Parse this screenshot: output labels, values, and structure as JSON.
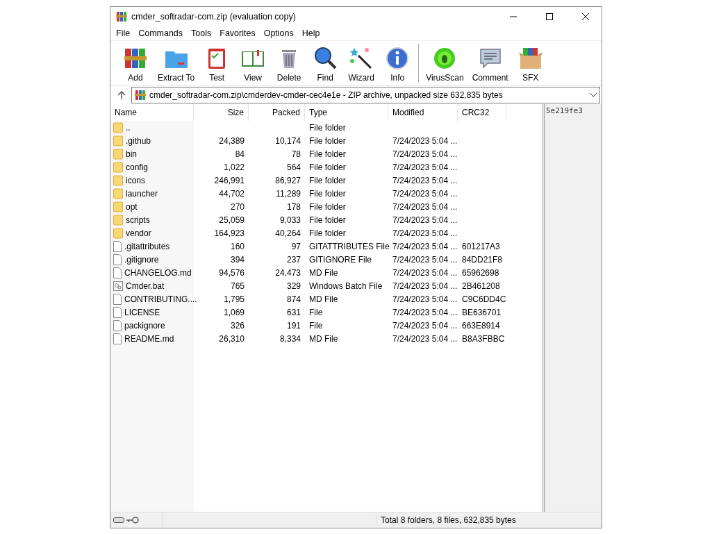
{
  "window": {
    "title": "cmder_softradar-com.zip (evaluation copy)"
  },
  "menu": [
    "File",
    "Commands",
    "Tools",
    "Favorites",
    "Options",
    "Help"
  ],
  "toolbar": [
    {
      "label": "Add",
      "kind": "add"
    },
    {
      "label": "Extract To",
      "kind": "extract"
    },
    {
      "label": "Test",
      "kind": "test"
    },
    {
      "label": "View",
      "kind": "view"
    },
    {
      "label": "Delete",
      "kind": "delete"
    },
    {
      "label": "Find",
      "kind": "find"
    },
    {
      "label": "Wizard",
      "kind": "wizard"
    },
    {
      "label": "Info",
      "kind": "info"
    },
    {
      "label": "VirusScan",
      "kind": "virus",
      "separated": true
    },
    {
      "label": "Comment",
      "kind": "comment"
    },
    {
      "label": "SFX",
      "kind": "sfx"
    }
  ],
  "address": "cmder_softradar-com.zip\\cmderdev-cmder-cec4e1e - ZIP archive, unpacked size 632,835 bytes",
  "table": {
    "columns": [
      "Name",
      "Size",
      "Packed",
      "Type",
      "Modified",
      "CRC32"
    ],
    "rows": [
      {
        "kind": "folder",
        "name": "..",
        "size": "",
        "packed": "",
        "type": "File folder",
        "modified": "",
        "crc": ""
      },
      {
        "kind": "folder",
        "name": ".github",
        "size": "24,389",
        "packed": "10,174",
        "type": "File folder",
        "modified": "7/24/2023 5:04 ...",
        "crc": ""
      },
      {
        "kind": "folder",
        "name": "bin",
        "size": "84",
        "packed": "78",
        "type": "File folder",
        "modified": "7/24/2023 5:04 ...",
        "crc": ""
      },
      {
        "kind": "folder",
        "name": "config",
        "size": "1,022",
        "packed": "564",
        "type": "File folder",
        "modified": "7/24/2023 5:04 ...",
        "crc": ""
      },
      {
        "kind": "folder",
        "name": "icons",
        "size": "246,991",
        "packed": "86,927",
        "type": "File folder",
        "modified": "7/24/2023 5:04 ...",
        "crc": ""
      },
      {
        "kind": "folder",
        "name": "launcher",
        "size": "44,702",
        "packed": "11,289",
        "type": "File folder",
        "modified": "7/24/2023 5:04 ...",
        "crc": ""
      },
      {
        "kind": "folder",
        "name": "opt",
        "size": "270",
        "packed": "178",
        "type": "File folder",
        "modified": "7/24/2023 5:04 ...",
        "crc": ""
      },
      {
        "kind": "folder",
        "name": "scripts",
        "size": "25,059",
        "packed": "9,033",
        "type": "File folder",
        "modified": "7/24/2023 5:04 ...",
        "crc": ""
      },
      {
        "kind": "folder",
        "name": "vendor",
        "size": "164,923",
        "packed": "40,264",
        "type": "File folder",
        "modified": "7/24/2023 5:04 ...",
        "crc": ""
      },
      {
        "kind": "file",
        "name": ".gitattributes",
        "size": "160",
        "packed": "97",
        "type": "GITATTRIBUTES File",
        "modified": "7/24/2023 5:04 ...",
        "crc": "601217A3"
      },
      {
        "kind": "file",
        "name": ".gitignore",
        "size": "394",
        "packed": "237",
        "type": "GITIGNORE File",
        "modified": "7/24/2023 5:04 ...",
        "crc": "84DD21F8"
      },
      {
        "kind": "file",
        "name": "CHANGELOG.md",
        "size": "94,576",
        "packed": "24,473",
        "type": "MD File",
        "modified": "7/24/2023 5:04 ...",
        "crc": "65962698"
      },
      {
        "kind": "batch",
        "name": "Cmder.bat",
        "size": "765",
        "packed": "329",
        "type": "Windows Batch File",
        "modified": "7/24/2023 5:04 ...",
        "crc": "2B461208"
      },
      {
        "kind": "file",
        "name": "CONTRIBUTING....",
        "size": "1,795",
        "packed": "874",
        "type": "MD File",
        "modified": "7/24/2023 5:04 ...",
        "crc": "C9C6DD4C"
      },
      {
        "kind": "file",
        "name": "LICENSE",
        "size": "1,069",
        "packed": "631",
        "type": "File",
        "modified": "7/24/2023 5:04 ...",
        "crc": "BE636701"
      },
      {
        "kind": "file",
        "name": "packignore",
        "size": "326",
        "packed": "191",
        "type": "File",
        "modified": "7/24/2023 5:04 ...",
        "crc": "663E8914"
      },
      {
        "kind": "file",
        "name": "README.md",
        "size": "26,310",
        "packed": "8,334",
        "type": "MD File",
        "modified": "7/24/2023 5:04 ...",
        "crc": "B8A3FBBC"
      }
    ]
  },
  "side_panel": {
    "text": "5e219fe3"
  },
  "status_bar": {
    "text": "Total 8 folders, 8 files, 632,835 bytes"
  }
}
